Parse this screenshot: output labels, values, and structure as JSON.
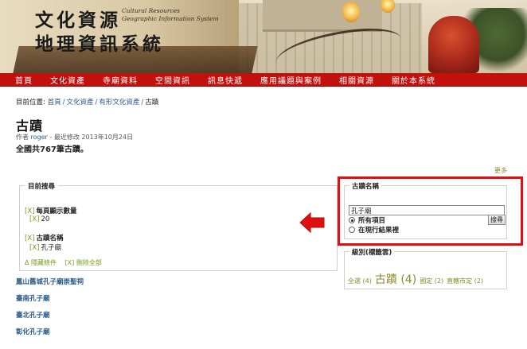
{
  "header": {
    "logo_line1": "文化資源",
    "logo_line2": "地理資訊系統",
    "logo_en_line1": "Cultural Resources",
    "logo_en_line2": "Geographic  Information System"
  },
  "nav": {
    "items": [
      {
        "label": "首頁"
      },
      {
        "label": "文化資產"
      },
      {
        "label": "寺廟資料"
      },
      {
        "label": "空間資訊"
      },
      {
        "label": "訊息快遞"
      },
      {
        "label": "應用議題與案例"
      },
      {
        "label": "相關資源"
      },
      {
        "label": "關於本系統"
      }
    ]
  },
  "breadcrumb": {
    "prefix": "目前位置:",
    "items": [
      {
        "label": "首頁"
      },
      {
        "label": "文化資產"
      },
      {
        "label": "有形文化資產"
      }
    ],
    "current": "古蹟",
    "sep": "/"
  },
  "page": {
    "title": "古蹟",
    "submitted_prefix": "作者",
    "author": "roger",
    "submitted_suffix": "- 最近修改 2013年10月24日",
    "total": "全國共767筆古蹟。",
    "more": "更多"
  },
  "current_search": {
    "title": "目前搜尋",
    "x_label": "[X]",
    "facets": [
      {
        "name": "每頁顯示數量",
        "value": "20"
      },
      {
        "name": "古蹟名稱",
        "value": "孔子廟"
      }
    ],
    "hide_conditions": "Δ 隱藏條件",
    "remove_all": "[X] 刪除全部"
  },
  "results": [
    {
      "label": "鳳山舊城孔子廟崇聖祠"
    },
    {
      "label": "臺南孔子廟"
    },
    {
      "label": "臺北孔子廟"
    },
    {
      "label": "彰化孔子廟"
    }
  ],
  "name_search": {
    "title": "古蹟名稱",
    "input_value": "孔子廟",
    "radio_all": "所有項目",
    "radio_results": "在現行結果裡",
    "radio_selected": "all",
    "button": "搜尋"
  },
  "level_block": {
    "title": "級別(標籤雲)",
    "tags": [
      {
        "label": "全選",
        "count": "(4)",
        "size": "s"
      },
      {
        "label": "古蹟",
        "count": "(4)",
        "size": "l"
      },
      {
        "label": "國定",
        "count": "(2)",
        "size": "s"
      },
      {
        "label": "直轄市定",
        "count": "(2)",
        "size": "s"
      }
    ]
  },
  "colors": {
    "nav_bg": "#c2110d",
    "link": "#2c5a8c",
    "facet_x": "#7a9a1a",
    "tag": "#8a8a2a",
    "highlight": "#e01010"
  },
  "icons": {
    "arrow": "red-left-arrow-icon"
  }
}
